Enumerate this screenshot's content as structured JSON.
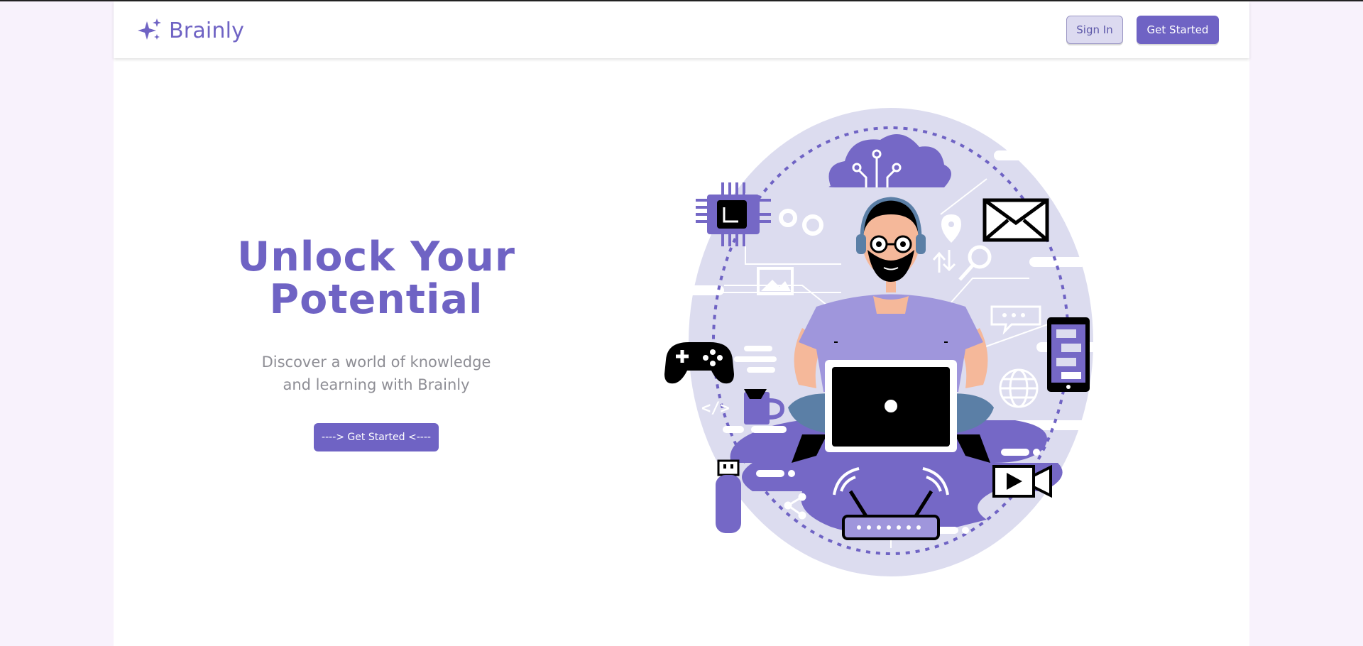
{
  "brand": {
    "name": "Brainly",
    "color": "#6f63c4"
  },
  "nav": {
    "sign_in": "Sign In",
    "get_started": "Get Started"
  },
  "hero": {
    "title_line1": "Unlock Your",
    "title_line2": "Potential",
    "subtitle_line1": "Discover a world of knowledge",
    "subtitle_line2": "and learning with Brainly",
    "cta": "----> Get Started <----"
  },
  "illustration": {
    "icons": [
      "cloud-icon",
      "chip-icon",
      "gears-icon",
      "location-pin-icon",
      "envelope-icon",
      "image-icon",
      "arrows-icon",
      "magnifier-icon",
      "chat-icon",
      "tablet-icon",
      "gamepad-icon",
      "code-icon",
      "mug-icon",
      "globe-icon",
      "usb-icon",
      "video-camera-icon",
      "share-icon",
      "router-icon",
      "person-icon",
      "laptop-icon"
    ],
    "accent": "#6f63c4",
    "bg": "#dcdcef"
  }
}
